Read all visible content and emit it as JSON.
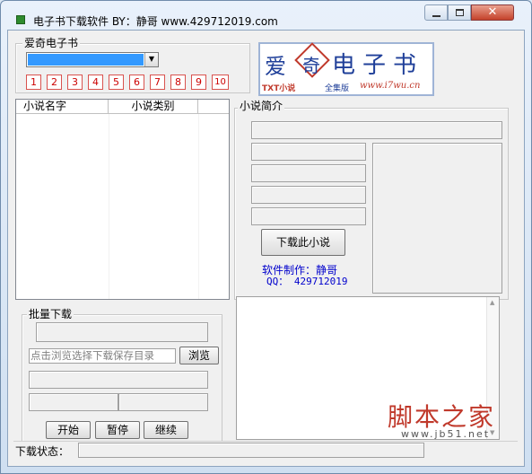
{
  "window": {
    "title": "电子书下载软件  BY：静哥   www.429712019.com",
    "controls": [
      "minimize-icon",
      "maximize-icon",
      "close-icon"
    ]
  },
  "source_group": {
    "legend": "爱奇电子书",
    "selected": "",
    "page_buttons": [
      "1",
      "2",
      "3",
      "4",
      "5",
      "6",
      "7",
      "8",
      "9",
      "10"
    ]
  },
  "logo": {
    "chars": [
      "爱",
      "奇",
      "电",
      "子",
      "书"
    ],
    "subtitle_left": "TXT小说",
    "subtitle_mid": "全集版",
    "url": "www.i7wu.cn"
  },
  "novel_list": {
    "col_name": "小说名字",
    "col_type": "小说类别",
    "rows": []
  },
  "intro_group": {
    "legend": "小说简介",
    "download_button": "下载此小说",
    "credit_line1": "软件制作：静哥",
    "credit_line2": "QQ： 429712019"
  },
  "batch_group": {
    "legend": "批量下载",
    "path_placeholder": "点击浏览选择下载保存目录",
    "browse_button": "浏览",
    "start_button": "开始",
    "pause_button": "暂停",
    "continue_button": "继续"
  },
  "status_bar": {
    "label": "下载状态：",
    "value": ""
  },
  "watermark": {
    "text": "脚本之家",
    "url": "www.jb51.net"
  },
  "colors": {
    "selection": "#3399ff",
    "logo_red": "#c0392b",
    "logo_blue": "#1f3f99",
    "credit_blue": "#0000cc"
  }
}
